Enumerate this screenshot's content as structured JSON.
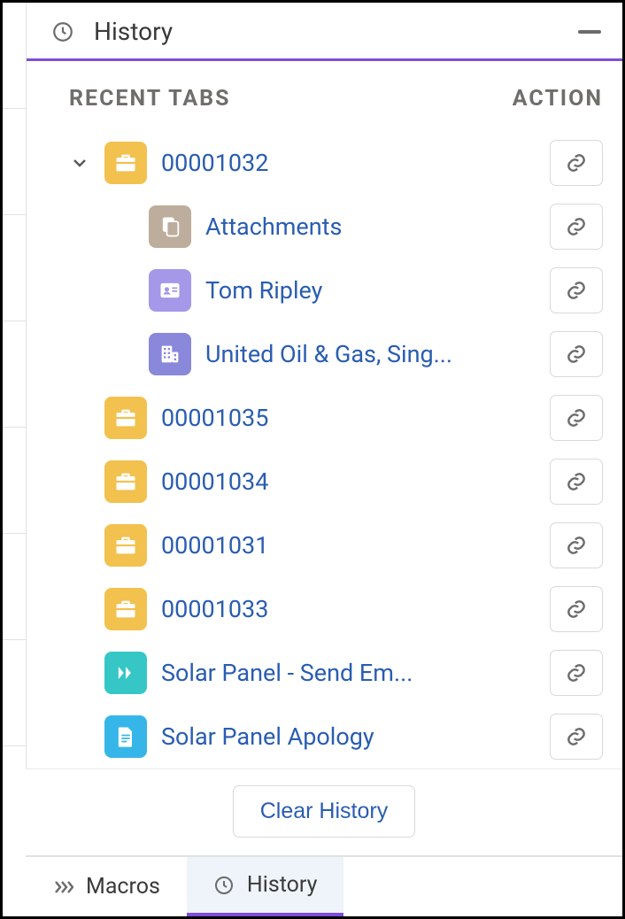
{
  "panel": {
    "title": "History",
    "columns": {
      "left": "RECENT TABS",
      "right": "ACTION"
    },
    "clear_label": "Clear History"
  },
  "items": [
    {
      "type": "case",
      "label": "00001032",
      "expanded": true
    },
    {
      "type": "attach",
      "label": "Attachments",
      "child": true
    },
    {
      "type": "contact",
      "label": "Tom Ripley",
      "child": true
    },
    {
      "type": "account",
      "label": "United Oil & Gas, Sing...",
      "child": true
    },
    {
      "type": "case",
      "label": "00001035"
    },
    {
      "type": "case",
      "label": "00001034"
    },
    {
      "type": "case",
      "label": "00001031"
    },
    {
      "type": "case",
      "label": "00001033"
    },
    {
      "type": "flow",
      "label": "Solar Panel - Send Em..."
    },
    {
      "type": "file",
      "label": "Solar Panel Apology"
    }
  ],
  "footer": {
    "macros": "Macros",
    "history": "History"
  }
}
